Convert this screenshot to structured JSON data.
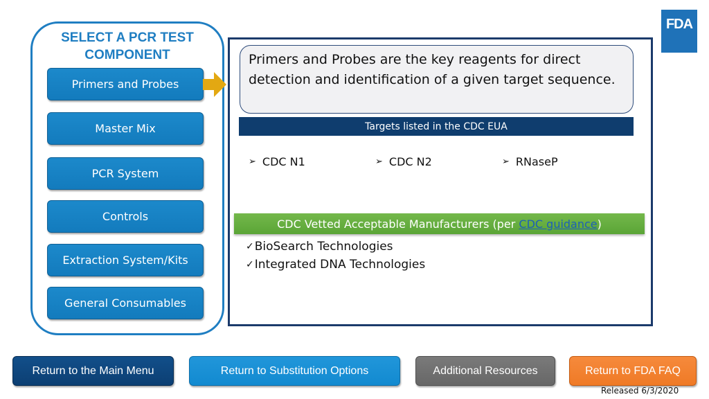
{
  "logo": {
    "text": "FDA",
    "icon": "fda-logo-icon"
  },
  "left_panel": {
    "title_line1": "SELECT A PCR TEST",
    "title_line2": "COMPONENT",
    "components": [
      {
        "label": "Primers and Probes",
        "selected": true
      },
      {
        "label": "Master Mix"
      },
      {
        "label": "PCR System"
      },
      {
        "label": "Controls"
      },
      {
        "label": "Extraction System/Kits"
      },
      {
        "label": "General Consumables"
      }
    ],
    "selection_indicator_icon": "right-arrow-icon"
  },
  "main": {
    "description": "Primers and Probes are the key reagents for direct detection and identification of a given target sequence.",
    "targets_header": "Targets listed in the CDC EUA",
    "targets": [
      {
        "bullet": "➢",
        "label": "CDC N1"
      },
      {
        "bullet": "➢",
        "label": "CDC N2"
      },
      {
        "bullet": "➢",
        "label": "RNaseP"
      }
    ],
    "manufacturers_header_prefix": "CDC Vetted Acceptable Manufacturers (per ",
    "manufacturers_header_link": "CDC guidance",
    "manufacturers_header_suffix": ")",
    "manufacturers": [
      {
        "check": "✓",
        "label": "BioSearch Technologies"
      },
      {
        "check": "✓",
        "label": "Integrated DNA Technologies"
      }
    ]
  },
  "footer": {
    "buttons": {
      "main_menu": "Return to the Main Menu",
      "substitution": "Return to Substitution Options",
      "resources": "Additional Resources",
      "faq": "Return to FDA FAQ"
    },
    "released": "Released 6/3/2020"
  },
  "colors": {
    "panel_blue": "#1f7ec2",
    "navy": "#0f3d6e",
    "green": "#5aa536",
    "gold_arrow": "#e3a812",
    "orange": "#ef7a26",
    "gray": "#6e6e6e"
  }
}
